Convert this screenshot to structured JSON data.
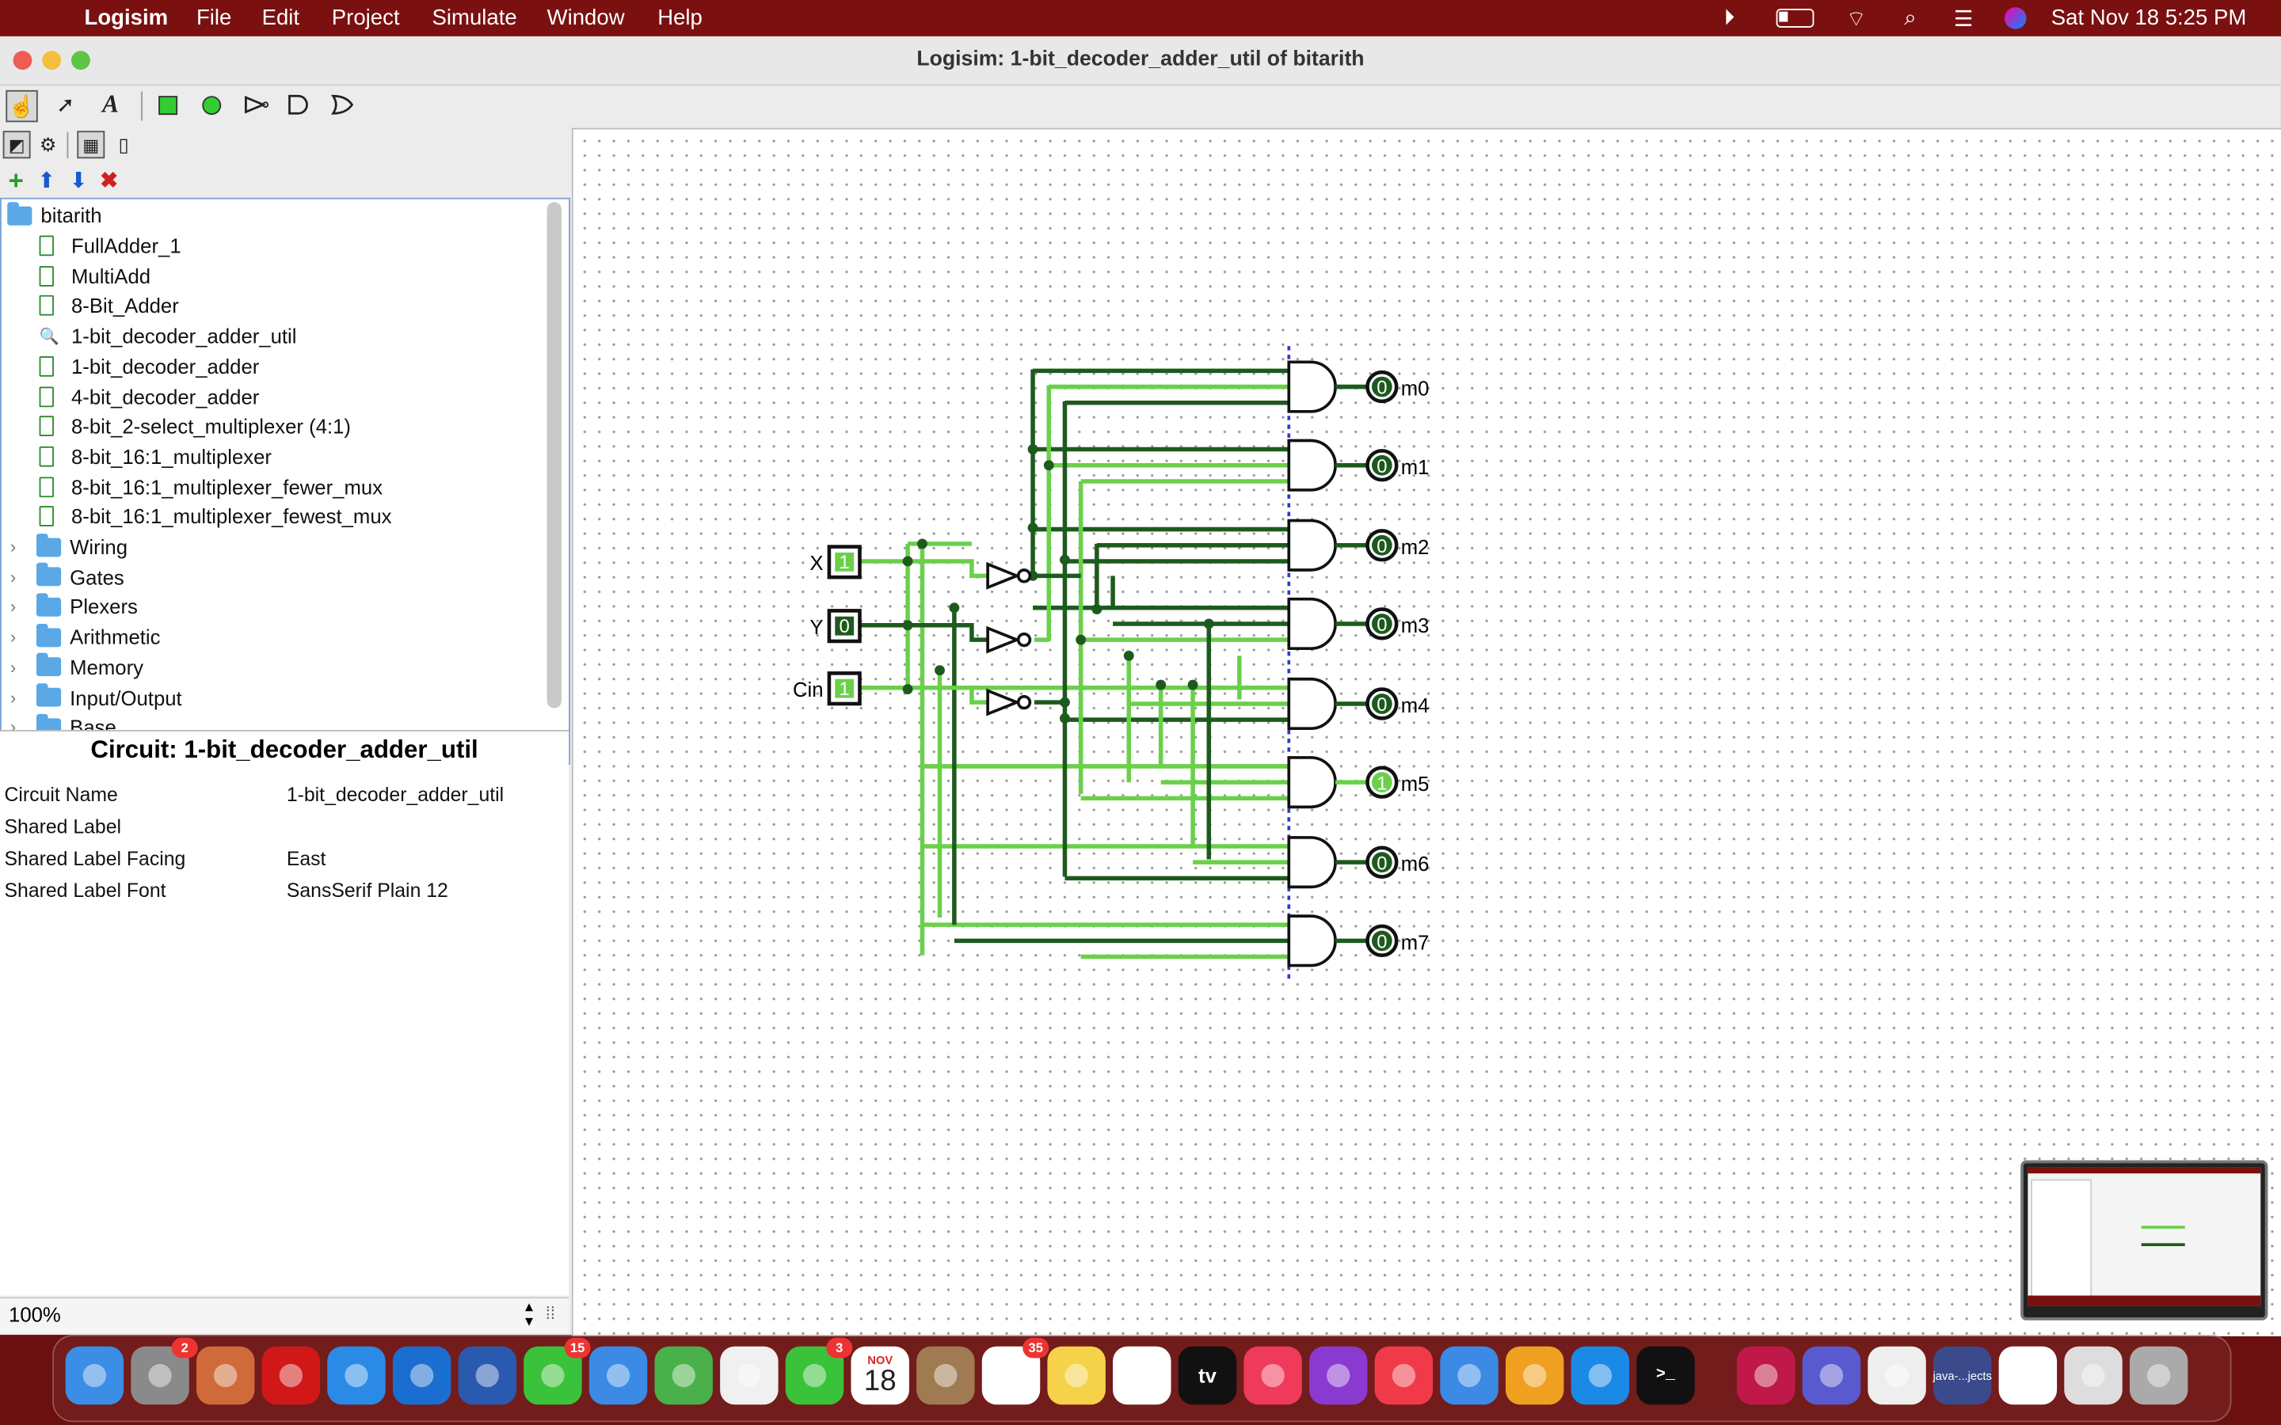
{
  "menubar": {
    "app": "Logisim",
    "items": [
      "File",
      "Edit",
      "Project",
      "Simulate",
      "Window",
      "Help"
    ],
    "clock": "Sat Nov 18  5:25 PM"
  },
  "window": {
    "title": "Logisim: 1-bit_decoder_adder_util of bitarith"
  },
  "toolbar": {
    "tools": [
      "poke-tool",
      "select-tool",
      "text-tool",
      "input-pin",
      "output-pin",
      "not-gate",
      "and-gate",
      "or-gate"
    ],
    "project_tools": [
      "edit-layout",
      "edit-appearance",
      "toggle-explorer",
      "toggle-attributes"
    ],
    "tree_tools": [
      "add-circuit",
      "move-up",
      "move-down",
      "delete-circuit"
    ]
  },
  "explorer": {
    "project": "bitarith",
    "circuits": [
      "FullAdder_1",
      "MultiAdd",
      "8-Bit_Adder",
      "1-bit_decoder_adder_util",
      "1-bit_decoder_adder",
      "4-bit_decoder_adder",
      "8-bit_2-select_multiplexer (4:1)",
      "8-bit_16:1_multiplexer",
      "8-bit_16:1_multiplexer_fewer_mux",
      "8-bit_16:1_multiplexer_fewest_mux"
    ],
    "active_circuit": "1-bit_decoder_adder_util",
    "libraries": [
      "Wiring",
      "Gates",
      "Plexers",
      "Arithmetic",
      "Memory",
      "Input/Output",
      "Base"
    ]
  },
  "attributes": {
    "title": "Circuit: 1-bit_decoder_adder_util",
    "rows": [
      {
        "name": "Circuit Name",
        "value": "1-bit_decoder_adder_util"
      },
      {
        "name": "Shared Label",
        "value": ""
      },
      {
        "name": "Shared Label Facing",
        "value": "East"
      },
      {
        "name": "Shared Label Font",
        "value": "SansSerif Plain 12"
      }
    ]
  },
  "zoom": "100%",
  "circuit": {
    "inputs": [
      {
        "label": "X",
        "value": "1"
      },
      {
        "label": "Y",
        "value": "0"
      },
      {
        "label": "Cin",
        "value": "1"
      }
    ],
    "outputs": [
      {
        "label": "m0",
        "value": "0"
      },
      {
        "label": "m1",
        "value": "0"
      },
      {
        "label": "m2",
        "value": "0"
      },
      {
        "label": "m3",
        "value": "0"
      },
      {
        "label": "m4",
        "value": "0"
      },
      {
        "label": "m5",
        "value": "1"
      },
      {
        "label": "m6",
        "value": "0"
      },
      {
        "label": "m7",
        "value": "0"
      }
    ],
    "colors": {
      "wire_on": "#6ad04a",
      "wire_off": "#1e5a1e",
      "accent": "#7a1010"
    }
  },
  "dock": {
    "apps": [
      "Finder",
      "System Settings",
      "Launchpad",
      "Opera",
      "Safari",
      "VS Code",
      "Word",
      "Messages",
      "Mail",
      "Maps",
      "Photos",
      "FaceTime",
      "Calendar",
      "Contacts",
      "Reminders",
      "Notes",
      "Freeform",
      "Apple TV",
      "Music",
      "Podcasts",
      "News",
      "Keynote",
      "Pages",
      "App Store",
      "Terminal",
      "Raspberry Pi Imager",
      "Teams",
      "TextEdit",
      "java-...jects",
      "Logisim",
      "Document Viewer",
      "Trash"
    ],
    "badges": {
      "System Settings": "2",
      "Messages": "15",
      "FaceTime": "3",
      "Reminders": "35"
    },
    "calendar_month": "NOV",
    "calendar_day": "18",
    "tv_label": "tv",
    "java_label": "java-...jects"
  }
}
